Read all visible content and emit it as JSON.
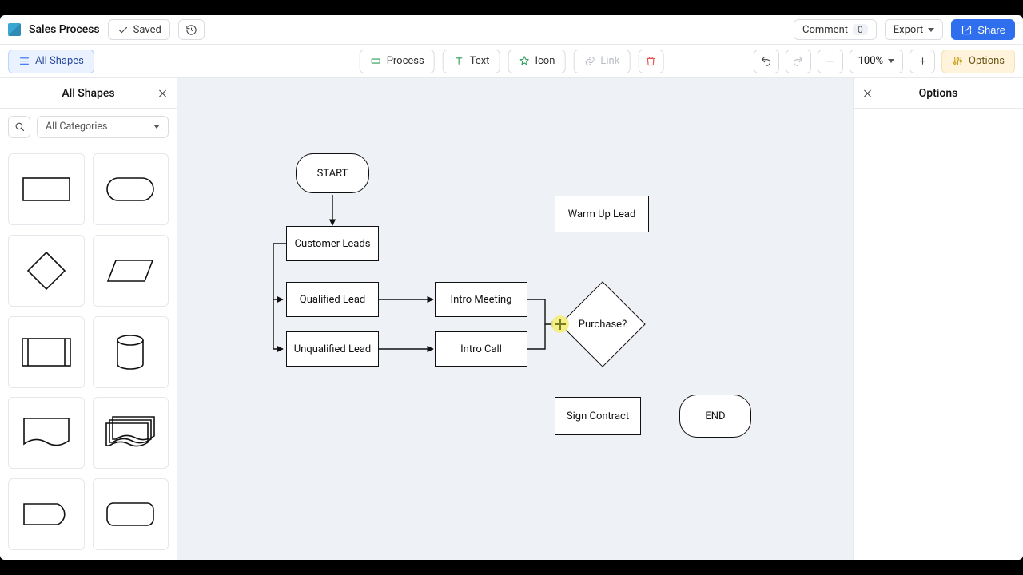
{
  "header": {
    "file_name": "Sales Process",
    "saved_label": "Saved",
    "comment_label": "Comment",
    "comment_count": "0",
    "export_label": "Export",
    "share_label": "Share"
  },
  "toolbar": {
    "all_shapes_label": "All Shapes",
    "process_label": "Process",
    "text_label": "Text",
    "icon_label": "Icon",
    "link_label": "Link",
    "zoom_label": "100%",
    "options_label": "Options"
  },
  "left_panel": {
    "title": "All Shapes",
    "category_label": "All Categories",
    "shapes": [
      "rectangle",
      "rounded-terminator",
      "diamond",
      "parallelogram",
      "predefined-process",
      "cylinder",
      "document",
      "multi-document",
      "rounded-left",
      "rounded-rect"
    ]
  },
  "right_panel": {
    "title": "Options"
  },
  "canvas": {
    "nodes": {
      "start": {
        "label": "START"
      },
      "customer_leads": {
        "label": "Customer Leads"
      },
      "qualified_lead": {
        "label": "Qualified Lead"
      },
      "unqualified_lead": {
        "label": "Unqualified Lead"
      },
      "intro_meeting": {
        "label": "Intro Meeting"
      },
      "intro_call": {
        "label": "Intro Call"
      },
      "warm_up_lead": {
        "label": "Warm Up Lead"
      },
      "purchase": {
        "label": "Purchase?"
      },
      "sign_contract": {
        "label": "Sign Contract"
      },
      "end": {
        "label": "END"
      }
    }
  },
  "chart_data": {
    "type": "flowchart",
    "title": "Sales Process",
    "nodes": [
      {
        "id": "start",
        "label": "START",
        "shape": "terminator"
      },
      {
        "id": "customer_leads",
        "label": "Customer Leads",
        "shape": "process"
      },
      {
        "id": "qualified_lead",
        "label": "Qualified Lead",
        "shape": "process"
      },
      {
        "id": "unqualified_lead",
        "label": "Unqualified Lead",
        "shape": "process"
      },
      {
        "id": "intro_meeting",
        "label": "Intro Meeting",
        "shape": "process"
      },
      {
        "id": "intro_call",
        "label": "Intro Call",
        "shape": "process"
      },
      {
        "id": "warm_up_lead",
        "label": "Warm Up Lead",
        "shape": "process"
      },
      {
        "id": "purchase",
        "label": "Purchase?",
        "shape": "decision"
      },
      {
        "id": "sign_contract",
        "label": "Sign Contract",
        "shape": "process"
      },
      {
        "id": "end",
        "label": "END",
        "shape": "terminator"
      }
    ],
    "edges": [
      {
        "from": "start",
        "to": "customer_leads"
      },
      {
        "from": "customer_leads",
        "to": "qualified_lead"
      },
      {
        "from": "customer_leads",
        "to": "unqualified_lead"
      },
      {
        "from": "qualified_lead",
        "to": "intro_meeting"
      },
      {
        "from": "unqualified_lead",
        "to": "intro_call"
      },
      {
        "from": "intro_meeting",
        "to": "purchase"
      },
      {
        "from": "intro_call",
        "to": "purchase"
      }
    ]
  }
}
